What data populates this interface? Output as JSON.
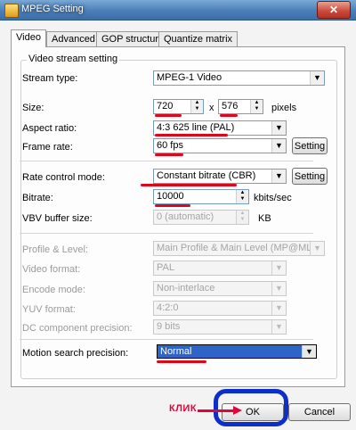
{
  "window": {
    "title": "MPEG Setting",
    "close_label": "✕"
  },
  "tabs": [
    {
      "label": "Video",
      "active": true
    },
    {
      "label": "Advanced",
      "active": false
    },
    {
      "label": "GOP structure",
      "active": false
    },
    {
      "label": "Quantize matrix",
      "active": false
    }
  ],
  "group": {
    "label": "Video stream setting"
  },
  "stream_type": {
    "label": "Stream type:",
    "value": "MPEG-1 Video"
  },
  "size": {
    "label": "Size:",
    "width": "720",
    "separator": "x",
    "height": "576",
    "unit": "pixels"
  },
  "aspect_ratio": {
    "label": "Aspect ratio:",
    "value": "4:3 625 line (PAL)"
  },
  "frame_rate": {
    "label": "Frame rate:",
    "value": "60 fps",
    "button": "Setting"
  },
  "rate_control": {
    "label": "Rate control mode:",
    "value": "Constant bitrate (CBR)",
    "button": "Setting"
  },
  "bitrate": {
    "label": "Bitrate:",
    "value": "10000",
    "unit": "kbits/sec"
  },
  "vbv": {
    "label": "VBV buffer size:",
    "value": "0 (automatic)",
    "unit": "KB"
  },
  "profile": {
    "label": "Profile & Level:",
    "value": "Main Profile & Main Level (MP@ML)"
  },
  "video_format": {
    "label": "Video format:",
    "value": "PAL"
  },
  "encode_mode": {
    "label": "Encode mode:",
    "value": "Non-interlace"
  },
  "yuv_format": {
    "label": "YUV format:",
    "value": "4:2:0"
  },
  "dc_precision": {
    "label": "DC component precision:",
    "value": "9 bits"
  },
  "motion_search": {
    "label": "Motion search precision:",
    "value": "Normal"
  },
  "footer": {
    "ok": "OK",
    "cancel": "Cancel"
  },
  "annotation": {
    "text": "КЛИК",
    "color": "#e0063a",
    "circle_color": "#0d2ec9",
    "underline_color": "#e0061a"
  }
}
